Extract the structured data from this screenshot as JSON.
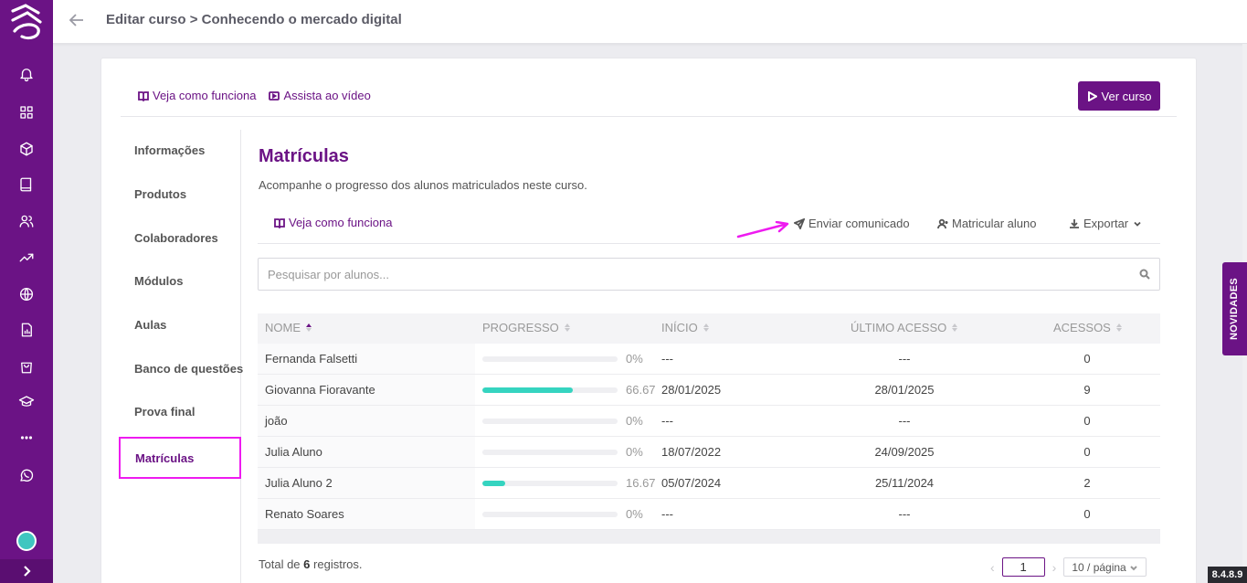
{
  "header": {
    "title": "Editar curso > Conhecendo o mercado digital"
  },
  "card": {
    "help_link": "Veja como funciona",
    "video_link": "Assista ao vídeo",
    "view_course_button": "Ver curso"
  },
  "nav": {
    "items": [
      "Informações",
      "Produtos",
      "Colaboradores",
      "Módulos",
      "Aulas",
      "Banco de questões",
      "Prova final"
    ],
    "active": "Matrículas"
  },
  "main": {
    "title": "Matrículas",
    "subtitle": "Acompanhe o progresso dos alunos matriculados neste curso.",
    "help_link": "Veja como funciona",
    "send_notice": "Enviar comunicado",
    "enroll_student": "Matricular aluno",
    "export": "Exportar",
    "search_placeholder": "Pesquisar por alunos..."
  },
  "table": {
    "columns": [
      "NOME",
      "PROGRESSO",
      "INÍCIO",
      "ÚLTIMO ACESSO",
      "ACESSOS"
    ],
    "rows": [
      {
        "name": "Fernanda Falsetti",
        "progress": 0,
        "progress_label": "0%",
        "start": "---",
        "last_access": "---",
        "accesses": "0"
      },
      {
        "name": "Giovanna Fioravante",
        "progress": 66.67,
        "progress_label": "66.67",
        "start": "28/01/2025",
        "last_access": "28/01/2025",
        "accesses": "9"
      },
      {
        "name": "joão",
        "progress": 0,
        "progress_label": "0%",
        "start": "---",
        "last_access": "---",
        "accesses": "0"
      },
      {
        "name": "Julia Aluno",
        "progress": 0,
        "progress_label": "0%",
        "start": "18/07/2022",
        "last_access": "24/09/2025",
        "accesses": "0"
      },
      {
        "name": "Julia Aluno 2",
        "progress": 16.67,
        "progress_label": "16.67",
        "start": "05/07/2024",
        "last_access": "25/11/2024",
        "accesses": "2"
      },
      {
        "name": "Renato Soares",
        "progress": 0,
        "progress_label": "0%",
        "start": "---",
        "last_access": "---",
        "accesses": "0"
      }
    ]
  },
  "footer": {
    "total_prefix": "Total de",
    "total_count": "6",
    "total_suffix": "registros.",
    "current_page": "1",
    "page_size": "10 / página"
  },
  "side": {
    "news_tab": "NOVIDADES",
    "version": "8.4.8.9"
  },
  "colors": {
    "brand": "#6b1385",
    "progress": "#35d4c0",
    "highlight": "#ee1bf0"
  }
}
